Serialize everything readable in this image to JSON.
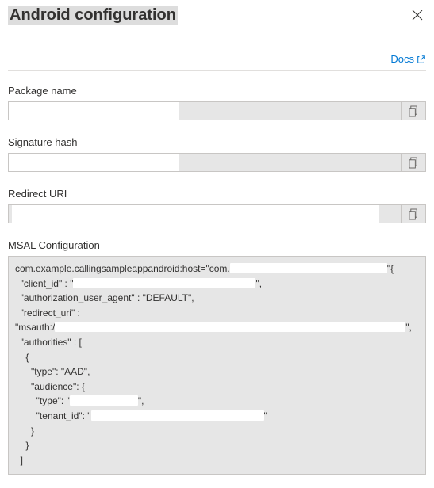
{
  "header": {
    "title": "Android configuration",
    "docs_label": "Docs"
  },
  "fields": {
    "package_name": {
      "label": "Package name",
      "value": ""
    },
    "signature_hash": {
      "label": "Signature hash",
      "value": ""
    },
    "redirect_uri": {
      "label": "Redirect URI",
      "value": ""
    }
  },
  "msal": {
    "label": "MSAL Configuration",
    "code": {
      "scheme_prefix": "com.example.callingsampleappandroid:host=\"com.",
      "scheme_suffix": "\"{",
      "client_id_key": "  \"client_id\" : \"",
      "client_id_suffix": "\",",
      "auth_agent": "  \"authorization_user_agent\" : \"DEFAULT\",",
      "redirect_key": "  \"redirect_uri\" :",
      "msauth_prefix": "\"msauth:/",
      "msauth_suffix": "\",",
      "authorities": "  \"authorities\" : [",
      "brace_open": "    {",
      "type_aad": "      \"type\": \"AAD\",",
      "audience_open": "      \"audience\": {",
      "aud_type_prefix": "        \"type\": \"",
      "aud_type_suffix": "\",",
      "tenant_prefix": "        \"tenant_id\": \"",
      "tenant_suffix": "\"",
      "brace_close_inner": "      }",
      "brace_close_mid": "    }",
      "bracket_close": "  ]"
    }
  }
}
